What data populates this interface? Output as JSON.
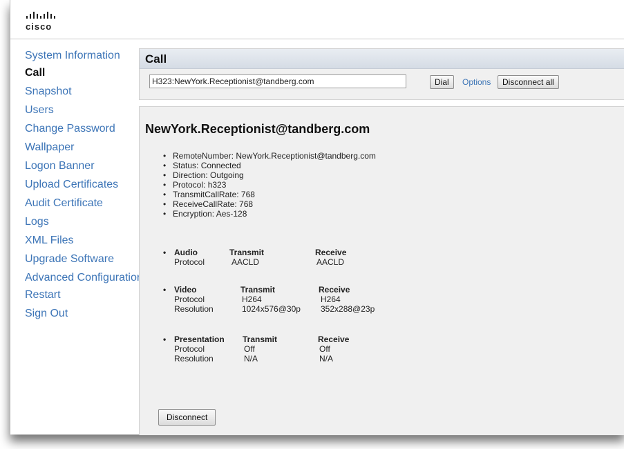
{
  "brand": {
    "name": "cisco"
  },
  "sidebar": {
    "items": [
      {
        "label": "System Information",
        "active": false
      },
      {
        "label": "Call",
        "active": true
      },
      {
        "label": "Snapshot",
        "active": false
      },
      {
        "label": "Users",
        "active": false
      },
      {
        "label": "Change Password",
        "active": false
      },
      {
        "label": "Wallpaper",
        "active": false
      },
      {
        "label": "Logon Banner",
        "active": false
      },
      {
        "label": "Upload Certificates",
        "active": false
      },
      {
        "label": "Audit Certificate",
        "active": false
      },
      {
        "label": "Logs",
        "active": false
      },
      {
        "label": "XML Files",
        "active": false
      },
      {
        "label": "Upgrade Software",
        "active": false
      },
      {
        "label": "Advanced Configuration",
        "active": false
      },
      {
        "label": "Restart",
        "active": false
      },
      {
        "label": "Sign Out",
        "active": false
      }
    ]
  },
  "call_panel": {
    "title": "Call",
    "dial_value": "H323:NewYork.Receptionist@tandberg.com",
    "dial_label": "Dial",
    "options_label": "Options",
    "disconnect_all_label": "Disconnect all"
  },
  "call_details": {
    "title": "NewYork.Receptionist@tandberg.com",
    "items": [
      "RemoteNumber: NewYork.Receptionist@tandberg.com",
      "Status: Connected",
      "Direction: Outgoing",
      "Protocol: h323",
      "TransmitCallRate: 768",
      "ReceiveCallRate: 768",
      "Encryption: Aes-128"
    ],
    "media": {
      "audio": {
        "title": "Audio",
        "transmit_header": "Transmit",
        "receive_header": "Receive",
        "rows": [
          {
            "label": "Protocol",
            "transmit": "AACLD",
            "receive": "AACLD"
          }
        ]
      },
      "video": {
        "title": "Video",
        "transmit_header": "Transmit",
        "receive_header": "Receive",
        "rows": [
          {
            "label": "Protocol",
            "transmit": "H264",
            "receive": "H264"
          },
          {
            "label": "Resolution",
            "transmit": "1024x576@30p",
            "receive": "352x288@23p"
          }
        ]
      },
      "presentation": {
        "title": "Presentation",
        "transmit_header": "Transmit",
        "receive_header": "Receive",
        "rows": [
          {
            "label": "Protocol",
            "transmit": "Off",
            "receive": "Off"
          },
          {
            "label": "Resolution",
            "transmit": "N/A",
            "receive": "N/A"
          }
        ]
      }
    },
    "disconnect_label": "Disconnect"
  },
  "colors": {
    "link": "#3d75b7",
    "panel_bg": "#f0f0f0",
    "title_bar": "#dfe4eb"
  }
}
